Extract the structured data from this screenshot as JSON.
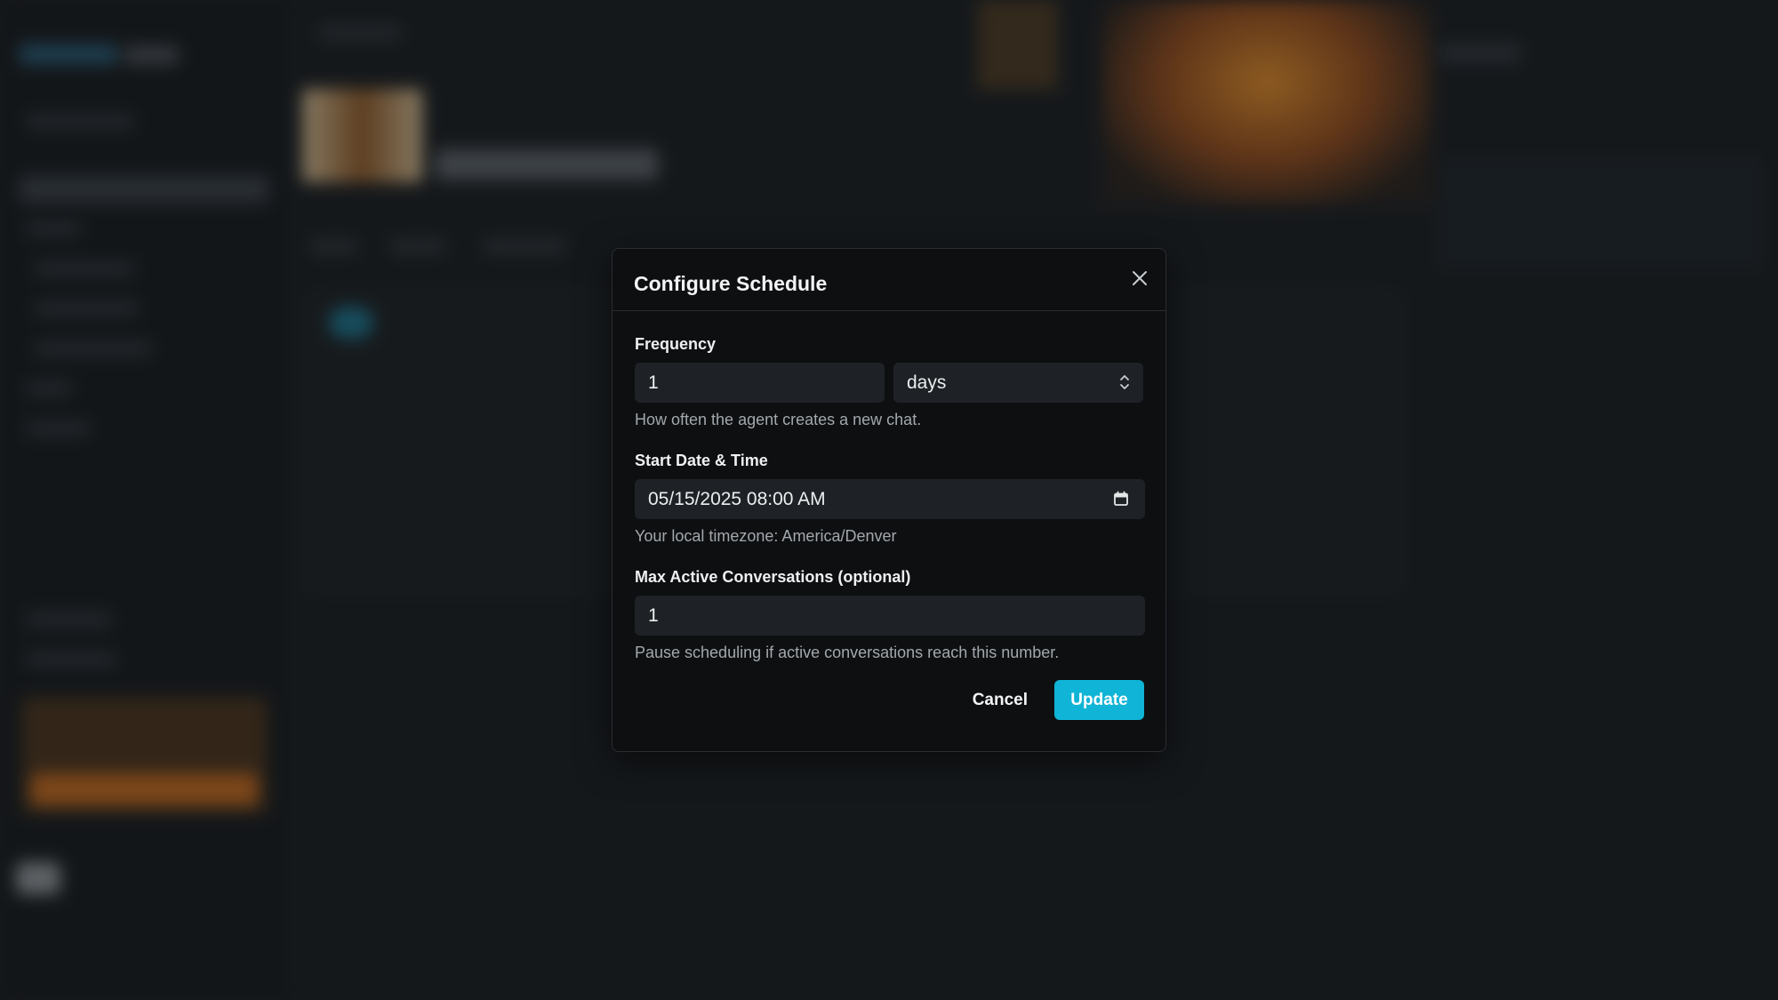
{
  "modal": {
    "title": "Configure Schedule",
    "frequency": {
      "label": "Frequency",
      "value": "1",
      "unit": "days",
      "hint": "How often the agent creates a new chat."
    },
    "start": {
      "label": "Start Date & Time",
      "value": "05/15/2025 08:00 AM",
      "hint": "Your local timezone: America/Denver"
    },
    "max_active": {
      "label": "Max Active Conversations (optional)",
      "value": "1",
      "hint": "Pause scheduling if active conversations reach this number."
    },
    "cancel_label": "Cancel",
    "update_label": "Update"
  },
  "colors": {
    "accent": "#10b4d6",
    "modal_bg": "#0d0f11",
    "input_bg": "#1e2226"
  },
  "icons": {
    "close": "close-icon",
    "select": "chevron-up-down-icon",
    "calendar": "calendar-icon"
  }
}
